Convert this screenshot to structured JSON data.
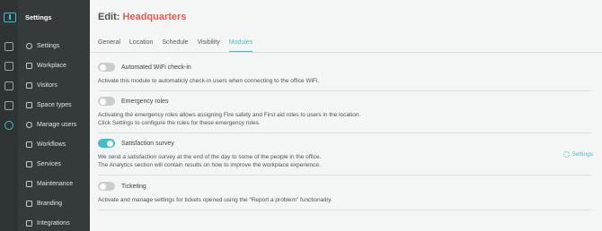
{
  "sidebar": {
    "title": "Settings",
    "items": [
      {
        "label": "Settings",
        "icon": "settings-circle-icon"
      },
      {
        "label": "Workplace",
        "icon": "briefcase-icon"
      },
      {
        "label": "Visitors",
        "icon": "visitor-badge-icon"
      },
      {
        "label": "Space types",
        "icon": "space-types-icon"
      },
      {
        "label": "Manage users",
        "icon": "users-icon"
      },
      {
        "label": "Workflows",
        "icon": "workflow-icon"
      },
      {
        "label": "Services",
        "icon": "services-icon"
      },
      {
        "label": "Maintenance",
        "icon": "wrench-icon"
      },
      {
        "label": "Branding",
        "icon": "branding-icon"
      },
      {
        "label": "Integrations",
        "icon": "plug-icon"
      }
    ]
  },
  "header": {
    "title_prefix": "Edit:",
    "title_name": "Headquarters"
  },
  "tabs": [
    {
      "label": "General"
    },
    {
      "label": "Location"
    },
    {
      "label": "Schedule"
    },
    {
      "label": "Visibility"
    },
    {
      "label": "Modules",
      "active": true
    }
  ],
  "modules": [
    {
      "name": "Automated WiFi check-in",
      "enabled": false,
      "description": [
        "Activate this module to automaticly check-in users when connecting to the office WiFi."
      ]
    },
    {
      "name": "Emergency roles",
      "enabled": false,
      "description": [
        "Activating the emergency roles allows assigning Fire safety and First aid roles to users in the location.",
        "Click Settings to configure the rules for these emergency roles."
      ]
    },
    {
      "name": "Satisfaction survey",
      "enabled": true,
      "description": [
        "We send a satisfaction survey at the end of the day to some of the people in the office.",
        "The Analytics section will contain results on how to improve the workplace experience."
      ],
      "settings_label": "Settings"
    },
    {
      "name": "Ticketing",
      "enabled": false,
      "description": [
        "Activate and manage settings for tickets opened using the \"Report a problem\" functionality."
      ]
    }
  ],
  "colors": {
    "accent": "#3fbfc7",
    "title_accent": "#e8594f",
    "sidebar_bg": "#353a3b"
  }
}
